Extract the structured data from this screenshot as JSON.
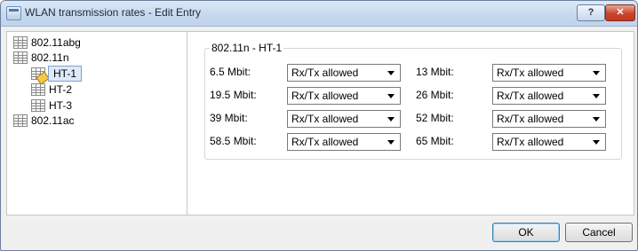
{
  "window": {
    "title": "WLAN transmission rates - Edit Entry"
  },
  "titlebar": {
    "help_label": "?",
    "close_label": "✕"
  },
  "tree": [
    {
      "label": "802.11abg"
    },
    {
      "label": "802.11n"
    },
    {
      "label": "HT-1",
      "selected": true
    },
    {
      "label": "HT-2"
    },
    {
      "label": "HT-3"
    },
    {
      "label": "802.11ac"
    }
  ],
  "group": {
    "title": "802.11n - HT-1"
  },
  "rates": [
    {
      "label": "6.5 Mbit:",
      "value": "Rx/Tx allowed"
    },
    {
      "label": "13 Mbit:",
      "value": "Rx/Tx allowed"
    },
    {
      "label": "19.5 Mbit:",
      "value": "Rx/Tx allowed"
    },
    {
      "label": "26 Mbit:",
      "value": "Rx/Tx allowed"
    },
    {
      "label": "39 Mbit:",
      "value": "Rx/Tx allowed"
    },
    {
      "label": "52 Mbit:",
      "value": "Rx/Tx allowed"
    },
    {
      "label": "58.5 Mbit:",
      "value": "Rx/Tx allowed"
    },
    {
      "label": "65 Mbit:",
      "value": "Rx/Tx allowed"
    }
  ],
  "buttons": {
    "ok": "OK",
    "cancel": "Cancel"
  }
}
